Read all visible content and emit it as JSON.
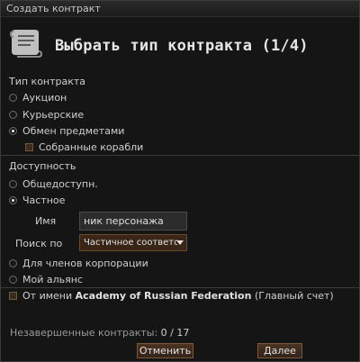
{
  "window": {
    "title": "Создать контракт",
    "heading": "Выбрать тип контракта (1/4)"
  },
  "contract_type": {
    "label": "Тип контракта",
    "options": [
      "Аукцион",
      "Курьерские",
      "Обмен предметами"
    ],
    "selected": "Обмен предметами",
    "sub_checkbox": "Собранные корабли"
  },
  "availability": {
    "label": "Доступность",
    "options": [
      "Общедоступн.",
      "Частное"
    ],
    "selected": "Частное",
    "name_label": "Имя",
    "name_value": "ник персонажа",
    "search_label": "Поиск по",
    "search_value": "Частичное соответствие",
    "corp_option": "Для членов корпорации",
    "alliance_option": "Мой альянс"
  },
  "on_behalf": {
    "prefix": "От имени",
    "corp": "Academy of Russian Federation",
    "suffix": "(Главный счет)"
  },
  "status": {
    "label": "Незавершенные контракты:",
    "value": "0 / 17"
  },
  "buttons": {
    "cancel": "Отменить",
    "next": "Далее"
  }
}
